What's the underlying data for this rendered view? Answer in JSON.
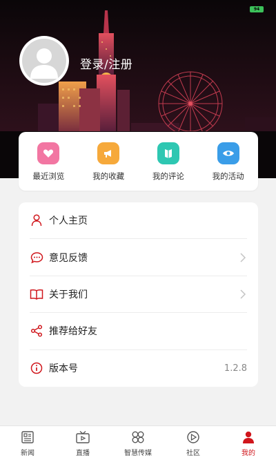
{
  "header": {
    "login_label": "登录/注册",
    "battery_label": "94"
  },
  "quick_actions": [
    {
      "label": "最近浏览",
      "icon": "heart-icon",
      "color": "#f276a2"
    },
    {
      "label": "我的收藏",
      "icon": "megaphone-icon",
      "color": "#f6a93b"
    },
    {
      "label": "我的评论",
      "icon": "book-icon",
      "color": "#2ec7b2"
    },
    {
      "label": "我的活动",
      "icon": "eye-icon",
      "color": "#3a9de8"
    }
  ],
  "menu": {
    "items": [
      {
        "label": "个人主页",
        "icon": "user-icon",
        "chevron": false
      },
      {
        "label": "意见反馈",
        "icon": "chat-bubble-icon",
        "chevron": true
      },
      {
        "label": "关于我们",
        "icon": "open-book-icon",
        "chevron": true
      },
      {
        "label": "推荐给好友",
        "icon": "share-icon",
        "chevron": false
      },
      {
        "label": "版本号",
        "icon": "info-icon",
        "value": "1.2.8"
      }
    ]
  },
  "tabs": [
    {
      "label": "新闻",
      "icon": "newspaper-icon",
      "active": false
    },
    {
      "label": "直播",
      "icon": "tv-icon",
      "active": false
    },
    {
      "label": "智慧传媒",
      "icon": "grid-clover-icon",
      "active": false
    },
    {
      "label": "社区",
      "icon": "play-circle-icon",
      "active": false
    },
    {
      "label": "我的",
      "icon": "person-icon",
      "active": true
    }
  ],
  "colors": {
    "accent": "#d0161c",
    "background": "#f2f2f2",
    "banner": "#0a0608"
  }
}
